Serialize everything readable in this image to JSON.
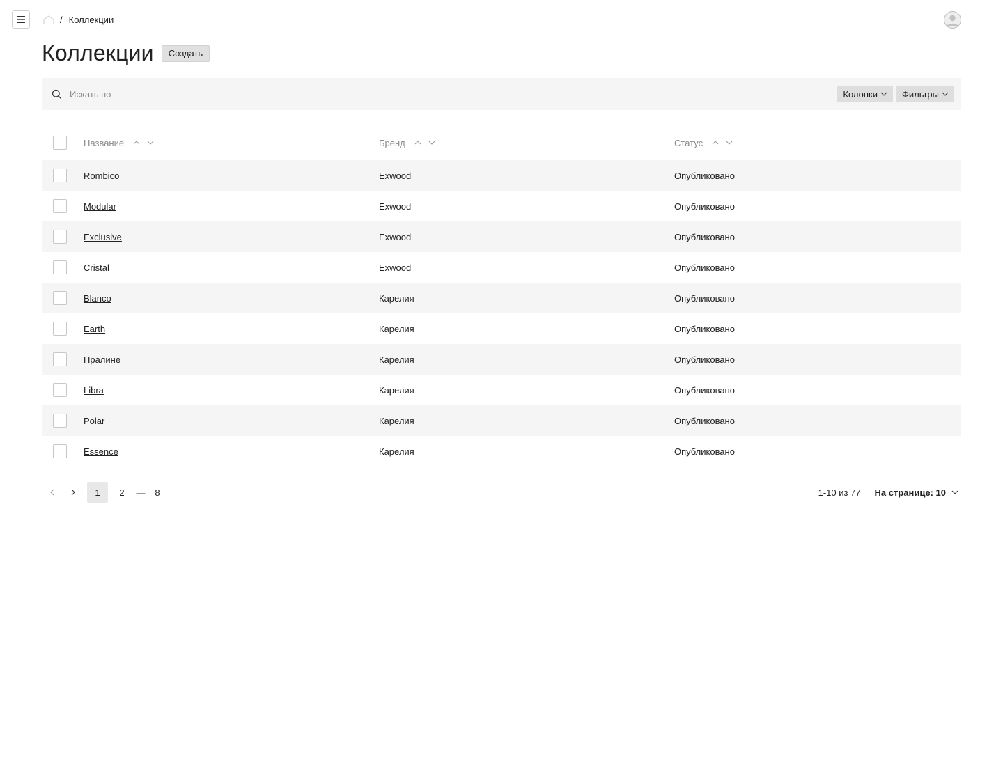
{
  "topbar": {
    "menu_icon": "hamburger-icon",
    "breadcrumb": {
      "home_icon": "home-icon",
      "separator": "/",
      "current": "Коллекции"
    },
    "avatar_icon": "user-avatar-icon"
  },
  "header": {
    "title": "Коллекции",
    "create_label": "Создать"
  },
  "search": {
    "placeholder": "Искать по",
    "value": "",
    "columns_label": "Колонки",
    "filters_label": "Фильтры"
  },
  "table": {
    "columns": {
      "name": "Название",
      "brand": "Бренд",
      "status": "Статус"
    },
    "rows": [
      {
        "name": "Rombico",
        "brand": "Exwood",
        "status": "Опубликовано"
      },
      {
        "name": "Modular",
        "brand": "Exwood",
        "status": "Опубликовано"
      },
      {
        "name": "Exclusive",
        "brand": "Exwood",
        "status": "Опубликовано"
      },
      {
        "name": "Cristal",
        "brand": "Exwood",
        "status": "Опубликовано"
      },
      {
        "name": "Blanco",
        "brand": "Карелия",
        "status": "Опубликовано"
      },
      {
        "name": "Earth",
        "brand": "Карелия",
        "status": "Опубликовано"
      },
      {
        "name": "Пралине",
        "brand": "Карелия",
        "status": "Опубликовано"
      },
      {
        "name": "Libra",
        "brand": "Карелия",
        "status": "Опубликовано"
      },
      {
        "name": "Polar",
        "brand": "Карелия",
        "status": "Опубликовано"
      },
      {
        "name": "Essence",
        "brand": "Карелия",
        "status": "Опубликовано"
      }
    ]
  },
  "pagination": {
    "pages": [
      "1",
      "2",
      "8"
    ],
    "ellipsis": "—",
    "current_page": "1",
    "range": "1-10 из 77",
    "per_page_label": "На странице: 10"
  },
  "colors": {
    "row_shade": "#f5f5f5",
    "button_bg": "#e0e0e0",
    "muted_text": "#8a8a8a",
    "text": "#222222"
  }
}
